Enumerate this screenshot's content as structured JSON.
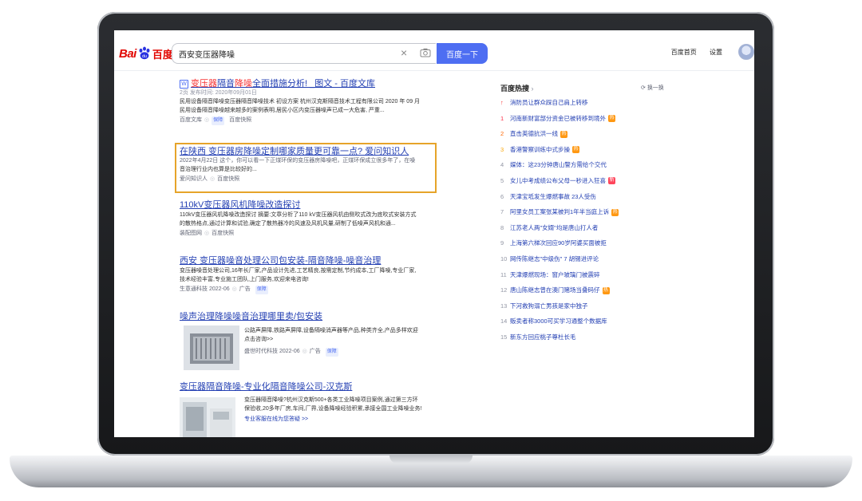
{
  "search": {
    "query": "西安变压器降噪",
    "button": "百度一下"
  },
  "brand": {
    "bai": "Bai",
    "du": "百度",
    "logo_color": "#e10601",
    "accent": "#4e6ef2"
  },
  "top_links": [
    "百度首页",
    "设置"
  ],
  "results": [
    {
      "title_parts": [
        "",
        "变压器",
        "隔音",
        "降噪",
        "全面措施分析! _图文 - 百度文库"
      ],
      "meta": "2页 发布时间: 2020年09月01日",
      "text": [
        "民用设备隔音降噪变压器隔音降噪技术 初设方案 杭州汉克斯隔音技术工程有限公司 2020 年 09 月",
        "民用设备隔音降噪越来越多的案例表明,居民小区内变压器噪声已成一大危害, 严重..."
      ],
      "source": "百度文库",
      "badge": "保障",
      "snapshot": "百度快照"
    },
    {
      "title": "在陕西 变压器房降噪定制哪家质量更可靠一点? 爱问知识人",
      "meta": "2022年4月22日 这个，你可以看一下正煤环保的变压器房降噪吧，正煤环保成立很多年了，在噪",
      "text": "音治理行业内也算是比较好的...",
      "source": "爱问知识人",
      "snapshot": "百度快照"
    },
    {
      "title": "110kV变压器风机降噪改造探讨",
      "text": [
        "110kV变压器风机降噪改造探讨 摘要:文章分析了110 kV变压器风机由侧吹式改为底吹式安装方式",
        "的散热格点,通过计算和试验,确定了散热器冷的风速及风机风量,研制了低噪声风机和通..."
      ],
      "source": "装配图网",
      "snapshot": "百度快照"
    },
    {
      "title": "西安 变压器噪音处理公司包安装-隔音降噪-噪音治理",
      "text": [
        "变压器噪音处理公司,16年长厂家,产品设计先进,工艺精良,按需定制,节约成本,工厂降噪,专业厂家,",
        "技术经验丰富,专业施工团队,上门服务,欢迎来电咨询!"
      ],
      "source": "生意通科技 2022-06",
      "ad": "广告",
      "badge": "保障"
    },
    {
      "title": "噪声治理降噪噪音治理哪里卖/包安装",
      "text": [
        "公路声屏障,铁路声屏障,设备隔噪消声器等产品,种类齐全,产品多样欢迎",
        "点击咨询>>"
      ],
      "source": "盛世时代科技 2022-06",
      "ad": "广告",
      "badge": "保障"
    },
    {
      "title": "变压器隔音降噪-专业化隔音降噪公司-汉克斯",
      "text": [
        "变压器隔音降噪?杭州汉克斯500+各类工业降噪项目案例,通过第三方环",
        "保验收,20多年厂房,车间,厂界,设备降噪经验积累,承接全国工业降噪业务!"
      ],
      "link": "专业客服在线为您答疑 >>"
    }
  ],
  "hotlist": {
    "title": "百度热搜",
    "refresh": "换一换",
    "items": [
      {
        "num": "",
        "text": "消防员让群众踩自己肩上转移",
        "tag": ""
      },
      {
        "num": "1",
        "text": "河南新财富部分资金已被转移到境外",
        "tag": "热"
      },
      {
        "num": "2",
        "text": "直击英德抗洪一线",
        "tag": "热"
      },
      {
        "num": "3",
        "text": "香港警察训练中式步操",
        "tag": "热"
      },
      {
        "num": "4",
        "text": "媒体：这23分钟唐山警方需给个交代",
        "tag": ""
      },
      {
        "num": "5",
        "text": "女儿中考成绩公布父母一秒进入狂喜",
        "tag": "新"
      },
      {
        "num": "6",
        "text": "天津宝坻发生爆燃事故 23人受伤",
        "tag": ""
      },
      {
        "num": "7",
        "text": "阿里女员工案张某被判1年半当庭上诉",
        "tag": "热"
      },
      {
        "num": "8",
        "text": "江苏老人两\"女婿\"均是唐山打人者",
        "tag": ""
      },
      {
        "num": "9",
        "text": "上海第六梯次回应90岁阿婆买面被拒",
        "tag": ""
      },
      {
        "num": "10",
        "text": "网传陈继志\"中级伤\" 7 胡锡进评论",
        "tag": ""
      },
      {
        "num": "11",
        "text": "天津爆燃现场：窗户玻璃门被震碎",
        "tag": ""
      },
      {
        "num": "12",
        "text": "唐山陈继志曾在澳门赌场当叠码仔",
        "tag": "热"
      },
      {
        "num": "13",
        "text": "下河救狗溺亡男孩是家中独子",
        "tag": ""
      },
      {
        "num": "14",
        "text": "贩卖者称3000可买学习通整个数据库",
        "tag": ""
      },
      {
        "num": "15",
        "text": "新东方回应桃子尊杜长毛",
        "tag": ""
      }
    ]
  }
}
